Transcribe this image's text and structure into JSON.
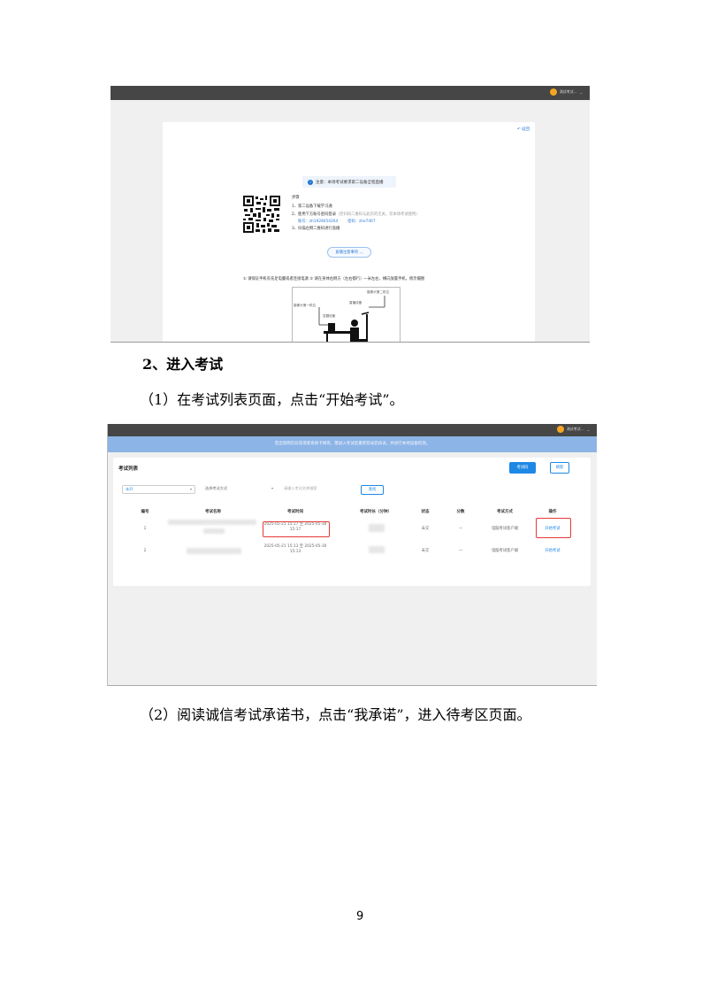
{
  "screenshot1": {
    "user_label": "测试考试...",
    "back_label": "返回",
    "notice": "注意：本场考试要求第二设备全程直播",
    "steps_title": "步骤",
    "steps": [
      "1、第二设备下载学习通",
      "2、使用下方账号密码登录",
      "3、扫描左侧二维码进行直播"
    ],
    "step2_hint": "（若扫码二维码与此页的无关，仅本场考试使用）",
    "account_label": "账号：",
    "account_value": "zh1928454264",
    "password_label": "密码：",
    "password_value": "zhe7467",
    "expand_button": "直播注意事项",
    "tips": "① 请保证手机有充足电量或者连接电源    ② 请在身体右侧方（左右都行）一米左右，横向放置手机，俯示摄图",
    "diagram_labels": {
      "second_position": "摄像头第二机位",
      "first_position": "摄像头第一机位",
      "live_device": "直播设备",
      "exam_device": "答题设备"
    }
  },
  "heading": "2、进入考试",
  "para1": "（1）在考试列表页面，点击“开始考试”。",
  "screenshot2": {
    "user_label": "测试考试...",
    "banner": "若出现网页异常或者系统卡顿等，需进入考试后重新登录后再试，并进行本地设备检测。",
    "panel_title": "考试列表",
    "btn_primary": "考试码",
    "btn_outline": "刷新",
    "filter_status": "未开",
    "filter_method": "选择考试方式",
    "search_placeholder": "请输入考试名称搜索",
    "query_button": "查找",
    "columns": [
      "编号",
      "考试名称",
      "考试时间",
      "考试时长（分钟）",
      "状态",
      "分数",
      "考试方式",
      "操作"
    ],
    "rows": [
      {
        "id": "1",
        "time": "2025-05-21 15:17 至 2025-05-30 15:17",
        "status": "未交",
        "score": "—",
        "method": "电脑考试客户端",
        "action": "开始考试"
      },
      {
        "id": "2",
        "time": "2025-05-21 15:13 至 2025-05-30 15:13",
        "status": "未交",
        "score": "—",
        "method": "电脑考试客户端",
        "action": "开始考试"
      }
    ]
  },
  "para2": "（2）阅读诚信考试承诺书，点击“我承诺”，进入待考区页面。",
  "page_number": "9",
  "colors": {
    "accent": "#1e88e5",
    "highlight": "#e53935",
    "topbar": "#464646"
  }
}
